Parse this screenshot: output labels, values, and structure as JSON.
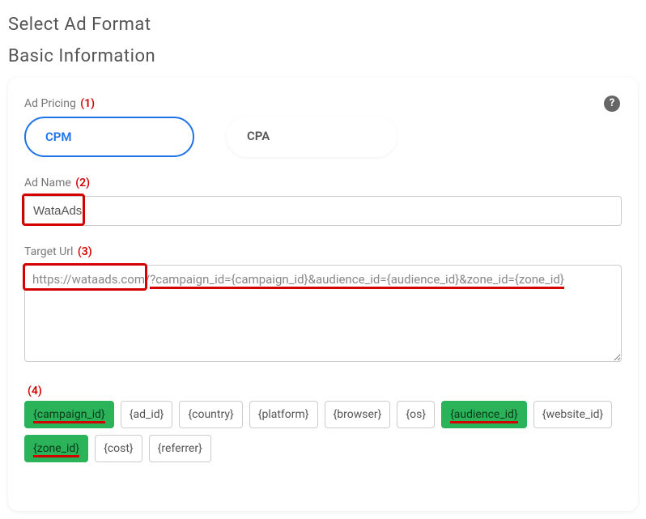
{
  "headings": {
    "select_ad_format": "Select Ad Format",
    "basic_information": "Basic Information"
  },
  "annotations": {
    "a1": "(1)",
    "a2": "(2)",
    "a3": "(3)",
    "a4": "(4)"
  },
  "help_icon": "?",
  "pricing": {
    "label": "Ad Pricing",
    "options": {
      "cpm": "CPM",
      "cpa": "CPA"
    },
    "selected": "cpm"
  },
  "ad_name": {
    "label": "Ad Name",
    "value": "WataAds"
  },
  "target_url": {
    "label": "Target Url",
    "base": "https://wataads.com/",
    "query": "?campaign_id={campaign_id}&audience_id={audience_id}&zone_id={zone_id}",
    "full": "https://wataads.com/?campaign_id={campaign_id}&audience_id={audience_id}&zone_id={zone_id}"
  },
  "tags": [
    {
      "text": "{campaign_id}",
      "selected": true
    },
    {
      "text": "{ad_id}",
      "selected": false
    },
    {
      "text": "{country}",
      "selected": false
    },
    {
      "text": "{platform}",
      "selected": false
    },
    {
      "text": "{browser}",
      "selected": false
    },
    {
      "text": "{os}",
      "selected": false
    },
    {
      "text": "{audience_id}",
      "selected": true
    },
    {
      "text": "{website_id}",
      "selected": false
    },
    {
      "text": "{zone_id}",
      "selected": true
    },
    {
      "text": "{cost}",
      "selected": false
    },
    {
      "text": "{referrer}",
      "selected": false
    }
  ]
}
